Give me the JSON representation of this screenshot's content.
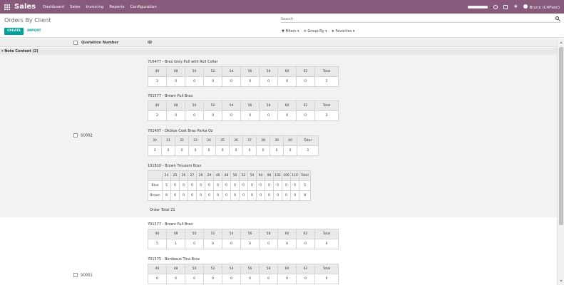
{
  "navbar": {
    "brand": "Sales",
    "menu": [
      "Dashboard",
      "Sales",
      "Invoicing",
      "Reports",
      "Configuration"
    ],
    "user": "Bruno (C4Flexi)",
    "progress": 1.0
  },
  "control_panel": {
    "title": "Orders By Client",
    "create_label": "CREATE",
    "import_label": "IMPORT",
    "search_placeholder": "Search",
    "filters_label": "Filters",
    "group_by_label": "Group By",
    "favorites_label": "Favorites"
  },
  "list": {
    "col_quotation": "Quotation Number",
    "col_id": "ID",
    "group_label": "▾ Note Content (2)"
  },
  "records": [
    {
      "name": "SO002",
      "order_total_label": "Order Total",
      "order_total": "21",
      "products": [
        {
          "title": "716477 - Brax Grey Pull with Roll Collar",
          "sizes": [
            "46",
            "48",
            "50",
            "52",
            "54",
            "56",
            "58",
            "60",
            "62",
            "Total"
          ],
          "values": [
            "3",
            "0",
            "0",
            "0",
            "0",
            "0",
            "0",
            "0",
            "0",
            "3"
          ]
        },
        {
          "title": "701577 - Brown Pull Brax",
          "sizes": [
            "46",
            "48",
            "50",
            "52",
            "54",
            "56",
            "58",
            "60",
            "62",
            "Total"
          ],
          "values": [
            "2",
            "0",
            "0",
            "0",
            "0",
            "0",
            "0",
            "0",
            "0",
            "2"
          ]
        },
        {
          "title": "701407 - Dkblue Coat Brax Parka Oz",
          "sizes": [
            "30",
            "31",
            "32",
            "33",
            "34",
            "35",
            "36",
            "37",
            "38",
            "39",
            "40",
            "Total"
          ],
          "values": [
            "3",
            "0",
            "0",
            "0",
            "0",
            "0",
            "0",
            "0",
            "0",
            "0",
            "0",
            "3"
          ]
        },
        {
          "title": "101810 - Brown Trousers Brax",
          "sizes": [
            "",
            "24",
            "25",
            "26",
            "27",
            "28",
            "29",
            "46",
            "48",
            "50",
            "52",
            "54",
            "94",
            "98",
            "102",
            "106",
            "110",
            "Total"
          ],
          "rows": [
            {
              "label": "Blue",
              "values": [
                "5",
                "0",
                "0",
                "0",
                "0",
                "0",
                "0",
                "0",
                "0",
                "0",
                "0",
                "0",
                "0",
                "0",
                "0",
                "0",
                "5"
              ]
            },
            {
              "label": "Brown",
              "values": [
                "8",
                "0",
                "0",
                "0",
                "0",
                "0",
                "0",
                "0",
                "0",
                "0",
                "0",
                "0",
                "0",
                "0",
                "0",
                "0",
                "8"
              ]
            }
          ]
        }
      ]
    },
    {
      "name": "SO001",
      "products": [
        {
          "title": "701577 - Brown Pull Brax",
          "sizes": [
            "46",
            "48",
            "50",
            "52",
            "54",
            "56",
            "58",
            "60",
            "62",
            "Total"
          ],
          "values": [
            "5",
            "1",
            "0",
            "0",
            "0",
            "0",
            "0",
            "0",
            "0",
            "6"
          ]
        },
        {
          "title": "701575 - Bordeaux Tina Brax",
          "sizes": [
            "46",
            "48",
            "50",
            "52",
            "54",
            "56",
            "58",
            "60",
            "62",
            "Total"
          ],
          "values": [
            "0",
            "0",
            "0",
            "0",
            "0",
            "0",
            "0",
            "0",
            "0",
            "0"
          ]
        }
      ]
    }
  ]
}
